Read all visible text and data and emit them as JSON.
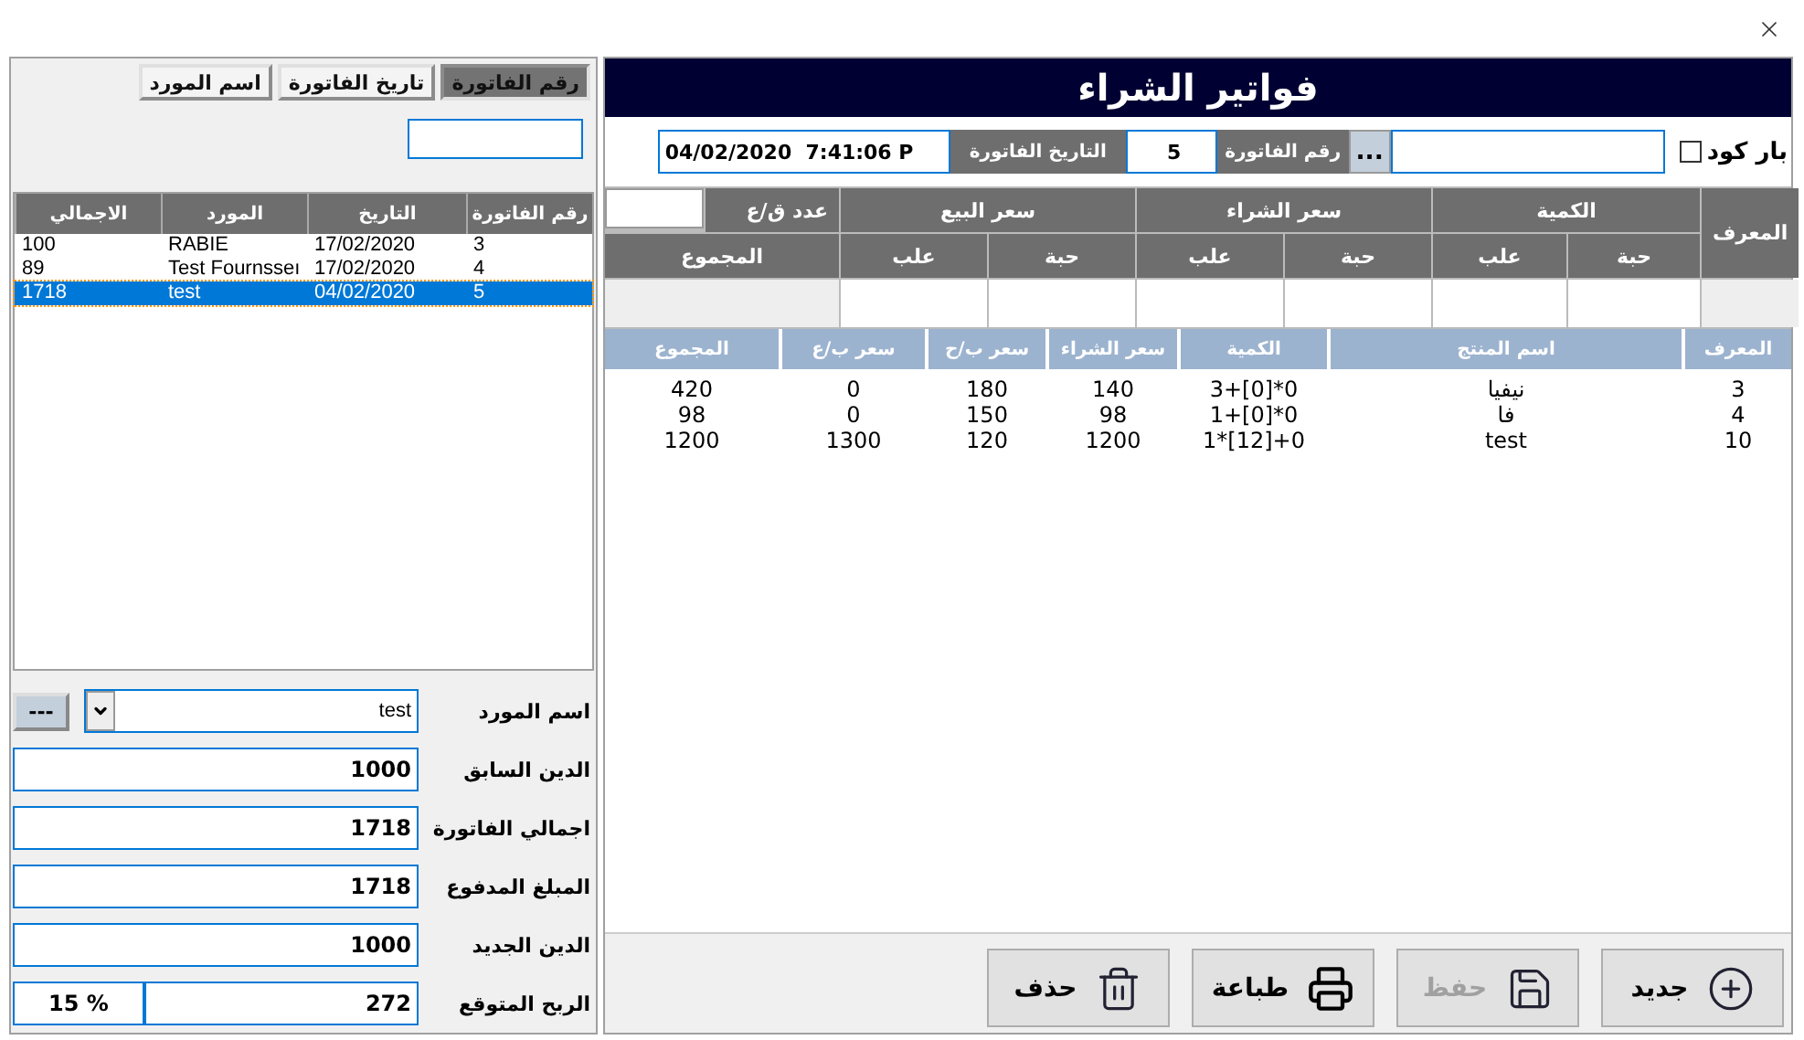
{
  "sort_tabs": [
    {
      "label": "رقم الفاتورة",
      "selected": true
    },
    {
      "label": "تاريخ الفاتورة",
      "selected": false
    },
    {
      "label": "اسم المورد",
      "selected": false
    }
  ],
  "invoices": {
    "columns": [
      "رقم الفاتورة",
      "التاريخ",
      "المورد",
      "الاجمالي"
    ],
    "rows": [
      {
        "cells": [
          "3",
          "17/02/2020",
          "RABIE",
          "100"
        ],
        "selected": false
      },
      {
        "cells": [
          "4",
          "17/02/2020",
          "Test Fournsseı",
          "89"
        ],
        "selected": false
      },
      {
        "cells": [
          "5",
          "04/02/2020",
          "test",
          "1718"
        ],
        "selected": true
      }
    ]
  },
  "supplier": {
    "label": "اسم المورد",
    "value": "test",
    "more_button": "---"
  },
  "summary": [
    {
      "label": "الدين السابق",
      "value": "1000"
    },
    {
      "label": "اجمالي الفاتورة",
      "value": "1718"
    },
    {
      "label": "المبلغ المدفوع",
      "value": "1718"
    },
    {
      "label": "الدين الجديد",
      "value": "1000"
    },
    {
      "label": "الربح المتوقع",
      "value": "272",
      "percent": "15 %"
    }
  ],
  "title": "فواتير الشراء",
  "barcode": {
    "label": "بار كود",
    "checked": false,
    "browse_button": "..."
  },
  "invoice_number": {
    "label": "رقم الفاتورة",
    "value": "5"
  },
  "invoice_date": {
    "label": "التاريخ الفاتورة",
    "value": "04/02/2020  7:41:06 P"
  },
  "entry_grid": {
    "id_label": "المعرف",
    "groups": [
      "الكمية",
      "سعر الشراء",
      "سعر البيع"
    ],
    "sub_labels": [
      "حبة",
      "علب",
      "حبة",
      "علب",
      "حبة",
      "علب"
    ],
    "count_label": "عدد ق/ع",
    "total_label": "المجموع"
  },
  "items": {
    "columns": [
      "المعرف",
      "اسم المنتج",
      "الكمية",
      "سعر الشراء",
      "سعر ب/ح",
      "سعر ب/ع",
      "المجموع"
    ],
    "rows": [
      [
        "3",
        "نيفيا",
        "3+[0]*0",
        "140",
        "180",
        "0",
        "420"
      ],
      [
        "4",
        "فا",
        "1+[0]*0",
        "98",
        "150",
        "0",
        "98"
      ],
      [
        "10",
        "test",
        "1*[12]+0",
        "1200",
        "120",
        "1300",
        "1200"
      ]
    ]
  },
  "buttons": [
    {
      "label": "جديد",
      "kind": "new",
      "disabled": false
    },
    {
      "label": "حفظ",
      "kind": "save",
      "disabled": true
    },
    {
      "label": "طباعة",
      "kind": "print",
      "disabled": false
    },
    {
      "label": "حذف",
      "kind": "delete",
      "disabled": false
    }
  ]
}
